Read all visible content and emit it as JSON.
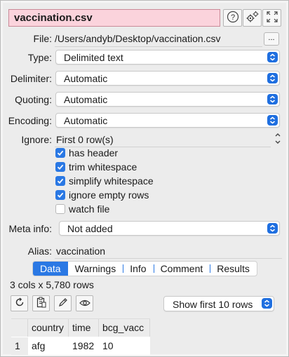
{
  "title": {
    "filename": "vaccination.csv"
  },
  "toolbar": {
    "help_icon": "question-circle-icon",
    "settings_icon": "gears-icon",
    "expand_icon": "expand-icon"
  },
  "form": {
    "file_label": "File:",
    "file_value": "/Users/andyb/Desktop/vaccination.csv",
    "browse_label": "...",
    "type_label": "Type:",
    "type_value": "Delimited text",
    "delimiter_label": "Delimiter:",
    "delimiter_value": "Automatic",
    "quoting_label": "Quoting:",
    "quoting_value": "Automatic",
    "encoding_label": "Encoding:",
    "encoding_value": "Automatic",
    "ignore_label": "Ignore:",
    "ignore_value": "First 0 row(s)",
    "checkboxes": [
      {
        "label": "has header",
        "checked": true
      },
      {
        "label": "trim whitespace",
        "checked": true
      },
      {
        "label": "simplify whitespace",
        "checked": true
      },
      {
        "label": "ignore empty rows",
        "checked": true
      },
      {
        "label": "watch file",
        "checked": false
      }
    ],
    "meta_label": "Meta info:",
    "meta_value": "Not added",
    "alias_label": "Alias:",
    "alias_value": "vaccination"
  },
  "tabs": [
    {
      "label": "Data",
      "active": true
    },
    {
      "label": "Warnings",
      "active": false
    },
    {
      "label": "Info",
      "active": false
    },
    {
      "label": "Comment",
      "active": false
    },
    {
      "label": "Results",
      "active": false
    }
  ],
  "summary": "3 cols x 5,780 rows",
  "show_rows": {
    "value": "Show first 10 rows"
  },
  "table": {
    "columns": [
      "",
      "country",
      "time",
      "bcg_vacc"
    ],
    "rows": [
      [
        "1",
        "afg",
        "1982",
        "10"
      ]
    ]
  },
  "colors": {
    "accent": "#2a78e4",
    "title_bg": "#fbd3dc"
  }
}
